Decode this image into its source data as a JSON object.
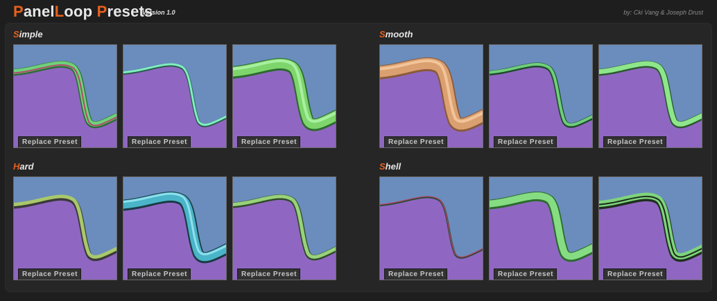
{
  "header": {
    "title_parts": [
      {
        "accent": "P",
        "rest": "anel"
      },
      {
        "accent": "L",
        "rest": "oop "
      },
      {
        "accent": "P",
        "rest": "resets"
      }
    ],
    "version": "Version 1.0",
    "credits": "by: Cki Vang & Joseph Drust"
  },
  "colors": {
    "accent": "#e8601c",
    "surface_blue": "#6a8dbd",
    "surface_purple": "#8f67c2"
  },
  "groups": [
    {
      "first": "S",
      "rest": "imple",
      "presets": [
        {
          "button": "Replace Preset",
          "style": "simple-1"
        },
        {
          "button": "Replace Preset",
          "style": "simple-2"
        },
        {
          "button": "Replace Preset",
          "style": "simple-3"
        }
      ]
    },
    {
      "first": "S",
      "rest": "mooth",
      "presets": [
        {
          "button": "Replace Preset",
          "style": "smooth-1"
        },
        {
          "button": "Replace Preset",
          "style": "smooth-2"
        },
        {
          "button": "Replace Preset",
          "style": "smooth-3"
        }
      ]
    },
    {
      "first": "H",
      "rest": "ard",
      "presets": [
        {
          "button": "Replace Preset",
          "style": "hard-1"
        },
        {
          "button": "Replace Preset",
          "style": "hard-2"
        },
        {
          "button": "Replace Preset",
          "style": "hard-3"
        }
      ]
    },
    {
      "first": "S",
      "rest": "hell",
      "presets": [
        {
          "button": "Replace Preset",
          "style": "shell-1"
        },
        {
          "button": "Replace Preset",
          "style": "shell-2"
        },
        {
          "button": "Replace Preset",
          "style": "shell-3"
        }
      ]
    }
  ]
}
